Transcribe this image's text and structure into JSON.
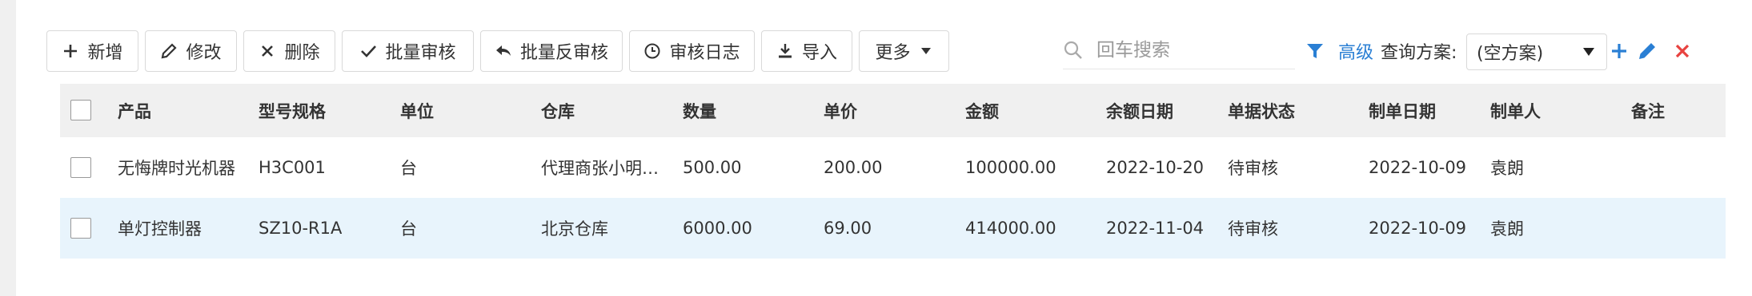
{
  "toolbar": {
    "add": "新增",
    "edit": "修改",
    "delete": "删除",
    "batch_approve": "批量审核",
    "batch_unapprove": "批量反审核",
    "audit_log": "审核日志",
    "import": "导入",
    "more": "更多"
  },
  "search": {
    "placeholder": "回车搜索"
  },
  "filter": {
    "advanced": "高级",
    "scheme_label": "查询方案:",
    "scheme_value": "(空方案)"
  },
  "table": {
    "columns": [
      "产品",
      "型号规格",
      "单位",
      "仓库",
      "数量",
      "单价",
      "金额",
      "余额日期",
      "单据状态",
      "制单日期",
      "制单人",
      "备注"
    ],
    "rows": [
      [
        "无悔牌时光机器",
        "H3C001",
        "台",
        "代理商张小明…",
        "500.00",
        "200.00",
        "100000.00",
        "2022-10-20",
        "待审核",
        "2022-10-09",
        "袁朗",
        ""
      ],
      [
        "单灯控制器",
        "SZ10-R1A",
        "台",
        "北京仓库",
        "6000.00",
        "69.00",
        "414000.00",
        "2022-11-04",
        "待审核",
        "2022-10-09",
        "袁朗",
        ""
      ]
    ]
  },
  "colors": {
    "accent_blue": "#2a7fd4",
    "danger_red": "#e8423f",
    "selected_row": "#e8f4fc",
    "header_bg": "#f0f0f0"
  }
}
